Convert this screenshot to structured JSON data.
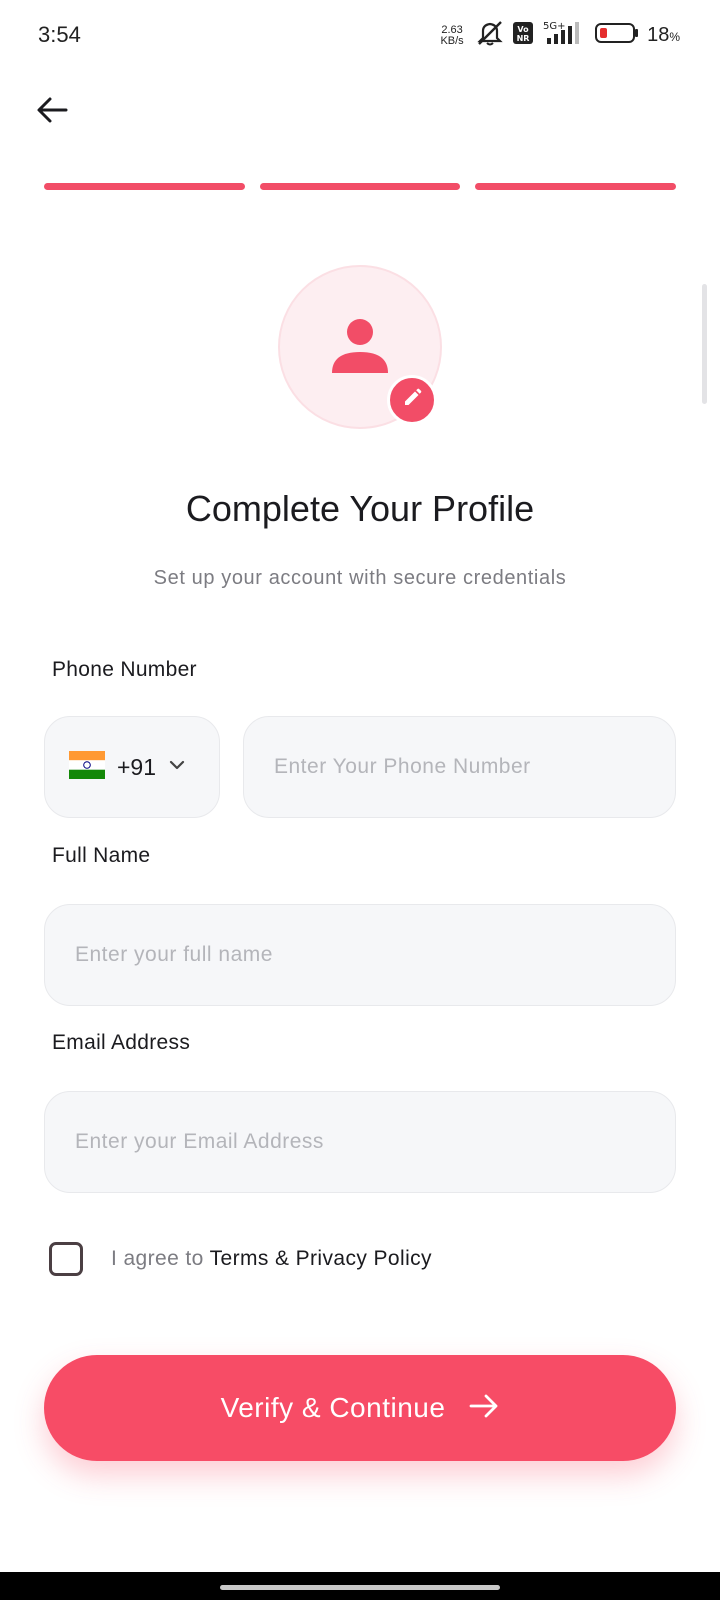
{
  "status_bar": {
    "time": "3:54",
    "net_speed_value": "2.63",
    "net_speed_unit": "KB/s",
    "volte_badge": "Vo NR",
    "network_type": "5G+",
    "battery_percent": "18",
    "battery_percent_sign": "%",
    "icons": [
      "mute-icon",
      "volte-icon",
      "signal-icon",
      "battery-icon"
    ]
  },
  "header": {
    "back_icon": "arrow-left-icon"
  },
  "progress": {
    "steps_total": 3,
    "steps_completed": 3,
    "color": "#f24d67"
  },
  "avatar": {
    "icon": "person-icon",
    "edit_icon": "pencil-icon"
  },
  "main": {
    "title": "Complete Your Profile",
    "subtitle": "Set up your account with secure credentials"
  },
  "form": {
    "phone": {
      "label": "Phone Number",
      "country_flag": "india-flag-icon",
      "country_code": "+91",
      "value": "",
      "placeholder": "Enter Your Phone Number"
    },
    "full_name": {
      "label": "Full Name",
      "value": "",
      "placeholder": "Enter your full name"
    },
    "email": {
      "label": "Email Address",
      "value": "",
      "placeholder": "Enter your Email Address"
    },
    "agree": {
      "checked": false,
      "prefix": "I agree to ",
      "link": "Terms & Privacy Policy"
    }
  },
  "cta": {
    "label": "Verify & Continue",
    "icon": "arrow-right-icon"
  },
  "colors": {
    "accent": "#f74c66",
    "input_bg": "#f6f7f9",
    "placeholder": "#b4b5ba"
  }
}
